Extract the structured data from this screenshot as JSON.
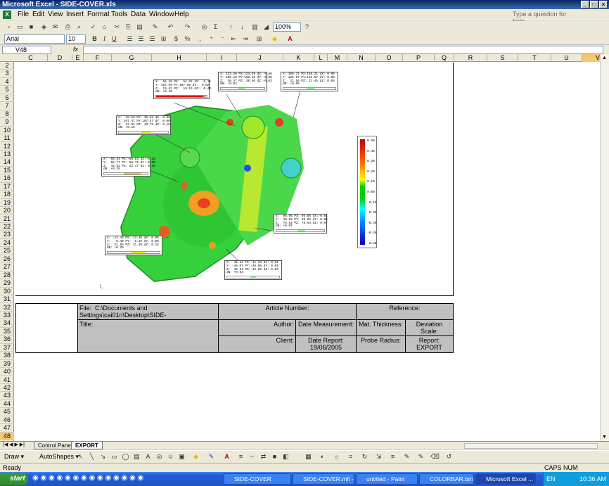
{
  "window": {
    "title": "Microsoft Excel - SIDE-COVER.xls"
  },
  "menu": [
    "File",
    "Edit",
    "View",
    "Insert",
    "Format",
    "Tools",
    "Data",
    "Window",
    "Help"
  ],
  "help_placeholder": "Type a question for help",
  "toolbar": {
    "zoom": "100%",
    "font": "Arial",
    "size": "10",
    "bold": "B",
    "italic": "I",
    "underline": "U",
    "currency": "$",
    "percent": "%",
    "sigma": "Σ"
  },
  "formula": {
    "namebox": "V48",
    "fx": "fx",
    "value": ""
  },
  "columns": [
    "C",
    "D",
    "E",
    "F",
    "G",
    "H",
    "I",
    "J",
    "K",
    "L",
    "M",
    "N",
    "O",
    "P",
    "Q",
    "R",
    "S",
    "T",
    "U",
    "V"
  ],
  "rows": [
    "2",
    "3",
    "4",
    "5",
    "6",
    "7",
    "8",
    "9",
    "10",
    "11",
    "12",
    "13",
    "14",
    "15",
    "16",
    "17",
    "18",
    "19",
    "20",
    "21",
    "22",
    "23",
    "24",
    "25",
    "26",
    "27",
    "28",
    "29",
    "30",
    "31",
    "32",
    "33",
    "34",
    "35",
    "36",
    "37",
    "38",
    "39",
    "40",
    "41",
    "42",
    "43",
    "44",
    "45",
    "46",
    "47",
    "48"
  ],
  "scale_labels": [
    "0.50",
    "0.40",
    "0.30",
    "0.20",
    "0.10",
    "0.00",
    "-0.10",
    "-0.20",
    "-0.30",
    "-0.40",
    "-0.50"
  ],
  "report": {
    "file_label": "File:",
    "file_value": "C:\\Documents and Settings\\cai01n\\Desktop\\SIDE-",
    "article": "Article Number:",
    "reference": "Reference:",
    "title": "Title:",
    "author": "Author:",
    "date_measurement": "Date Measurement:",
    "mat_thickness": "Mat. Thickness:",
    "deviation_scale": "Deviation Scale:",
    "client": "Client:",
    "date_report": "Date Report:",
    "date_report_value": "19/06/2005",
    "probe_radius": "Probe Radius:",
    "report_label": "Report:",
    "report_value": "EXPORT"
  },
  "tabs": [
    "Control Panel",
    "EXPORT"
  ],
  "draw": {
    "draw": "Draw ▾",
    "autoshapes": "AutoShapes ▾"
  },
  "status": {
    "left": "Ready",
    "right": "CAPS  NUM"
  },
  "taskbar": {
    "start": "start",
    "tasks": [
      "SIDE-COVER",
      "SIDE-COVER.mfi - ...",
      "untitled - Paint",
      "COLORBAR.bmp -...",
      "Microsoft Excel ..."
    ],
    "lang": "EN",
    "time": "10:36 AM"
  },
  "colors": {
    "accent": "#0a246a",
    "sheet_bg": "#ffffff",
    "report_fill": "#c0c0c0"
  }
}
